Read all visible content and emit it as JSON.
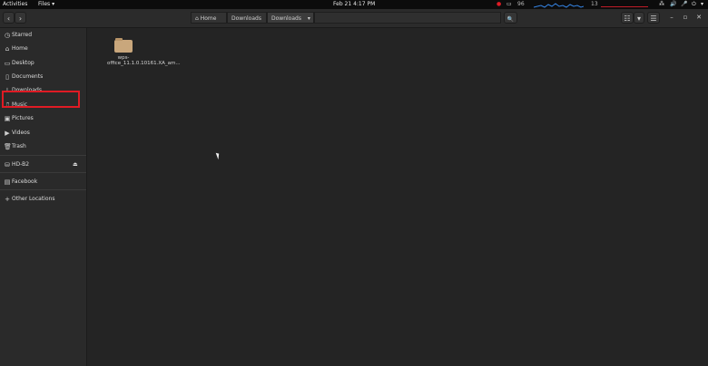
{
  "topbar": {
    "activities": "Activities",
    "app_menu": "Files ▾",
    "clock": "Feb 21  4:17 PM",
    "indicator_1": "96",
    "indicator_2": "13"
  },
  "header": {
    "back_icon": "‹",
    "forward_icon": "›",
    "path": [
      "Home",
      "Downloads",
      "Downloads"
    ],
    "path_dropdown_icon": "▾",
    "search_icon": "🔍",
    "view_toggle_icon": "☷",
    "sort_icon": "▾",
    "menu_icon": "☰",
    "minimize_icon": "–",
    "maximize_icon": "▫",
    "close_icon": "✕"
  },
  "sidebar": {
    "items": [
      {
        "icon": "◷",
        "label": "Starred"
      },
      {
        "icon": "⌂",
        "label": "Home"
      },
      {
        "icon": "▭",
        "label": "Desktop"
      },
      {
        "icon": "▯",
        "label": "Documents"
      },
      {
        "icon": "↓",
        "label": "Downloads"
      },
      {
        "icon": "♫",
        "label": "Music"
      },
      {
        "icon": "▣",
        "label": "Pictures"
      },
      {
        "icon": "▶",
        "label": "Videos"
      },
      {
        "icon": "🗑",
        "label": "Trash"
      },
      {
        "icon": "⛁",
        "label": "HD-B2"
      },
      {
        "icon": "▤",
        "label": "Facebook"
      },
      {
        "icon": "+",
        "label": "Other Locations"
      }
    ],
    "eject_icon": "⏏"
  },
  "files": [
    {
      "name": "wps-office_11.1.0.10161.XA_am..."
    }
  ]
}
